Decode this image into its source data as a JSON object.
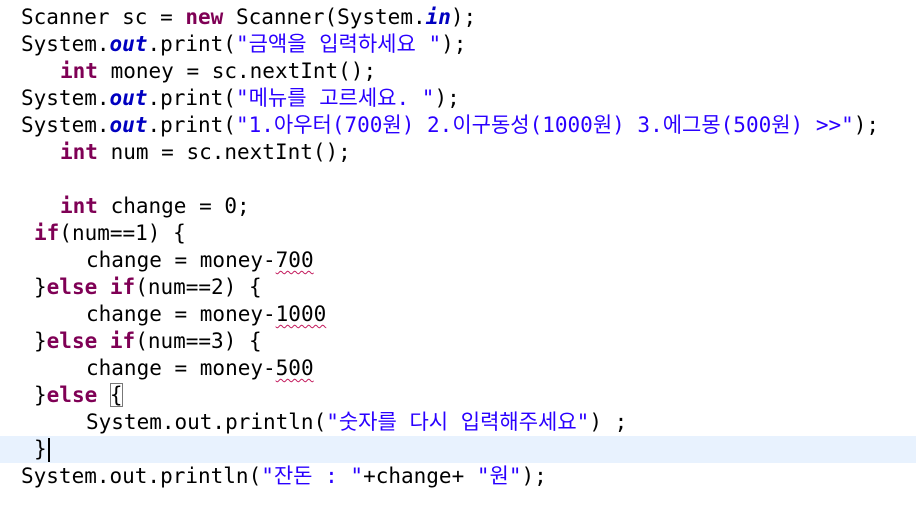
{
  "editor": {
    "language": "java",
    "current_line_index": 16,
    "colors": {
      "background": "#ffffff",
      "current_line": "#e8f2fe",
      "keyword": "#7f0055",
      "static_field": "#0000c0",
      "string": "#2a00ff",
      "plain": "#000000",
      "warning_underline": "#c2185b"
    },
    "lines": [
      {
        "t1": "Scanner sc = ",
        "k1": "new",
        "t2": " Scanner(System.",
        "f1": "in",
        "t3": ");"
      },
      {
        "t1": "System.",
        "f1": "out",
        "t2": ".print(",
        "s1": "\"금액을 입력하세요 \"",
        "t3": ");"
      },
      {
        "k1": "int",
        "t1": " money = sc.nextInt();"
      },
      {
        "t1": "System.",
        "f1": "out",
        "t2": ".print(",
        "s1": "\"메뉴를 고르세요. \"",
        "t3": ");"
      },
      {
        "t1": "System.",
        "f1": "out",
        "t2": ".print(",
        "s1": "\"1.아우터(700원) 2.이구동성(1000원) 3.에그몽(500원) >>\"",
        "t3": ");"
      },
      {
        "k1": "int",
        "t1": " num = sc.nextInt();"
      },
      {},
      {
        "k1": "int",
        "t1": " change = 0;"
      },
      {
        "k1": "if",
        "t1": "(num==1) {"
      },
      {
        "t1": "change = money-",
        "w1": "700"
      },
      {
        "t1": "}",
        "k1": "else",
        "t2": " ",
        "k2": "if",
        "t3": "(num==2) {"
      },
      {
        "t1": "change = money-",
        "w1": "1000"
      },
      {
        "t1": "}",
        "k1": "else",
        "t2": " ",
        "k2": "if",
        "t3": "(num==3) {"
      },
      {
        "t1": "change = money-",
        "w1": "500"
      },
      {
        "t1": "}",
        "k1": "else",
        "t2": " ",
        "b1": "{"
      },
      {
        "t1": "System.out.println(",
        "s1": "\"숫자를 다시 입력해주세요\"",
        "t2": ") ;"
      },
      {
        "b1": "}"
      },
      {
        "t1": "System.out.println(",
        "s1": "\"잔돈 : \"",
        "t2": "+change+ ",
        "s2": "\"원\"",
        "t3": ");"
      }
    ]
  }
}
